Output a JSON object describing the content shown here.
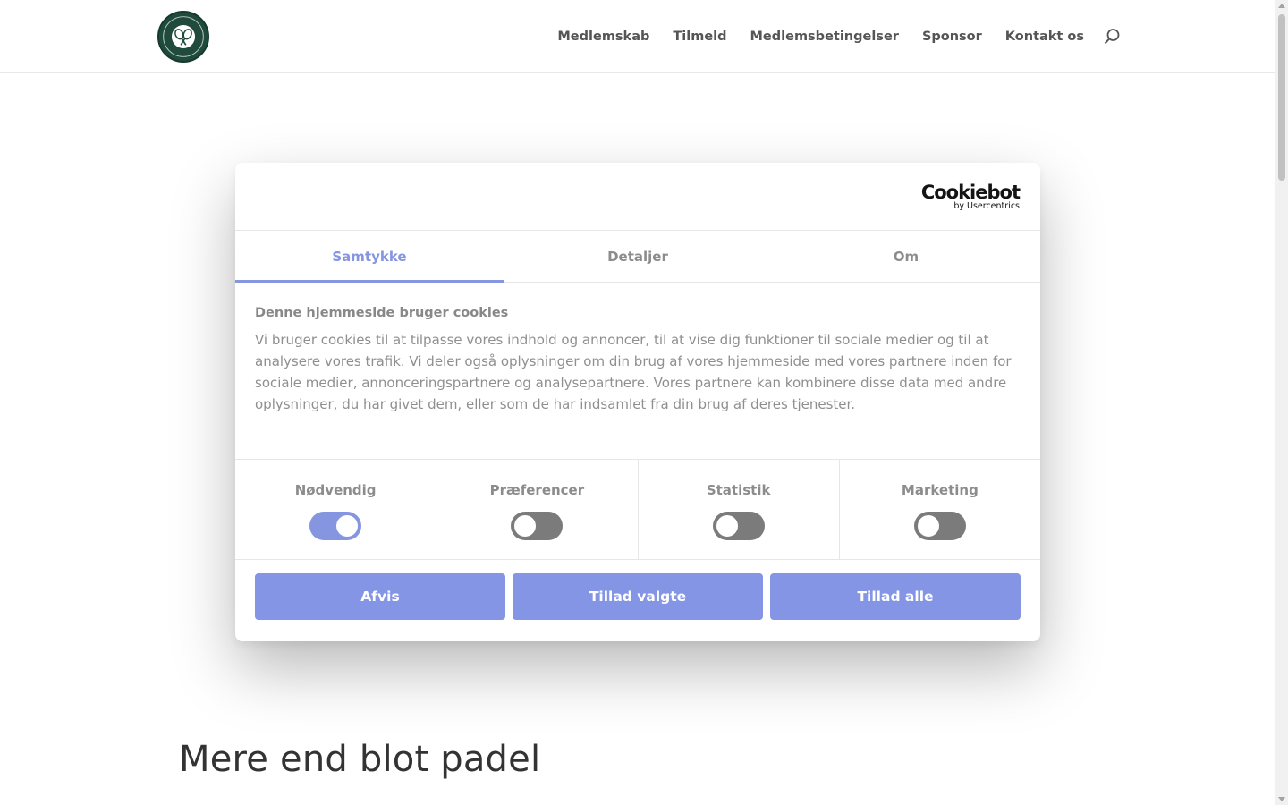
{
  "nav": {
    "items": [
      "Medlemskab",
      "Tilmeld",
      "Medlemsbetingelser",
      "Sponsor",
      "Kontakt os"
    ]
  },
  "icons": {
    "search": "search-icon",
    "logo": "club-logo-icon"
  },
  "colors": {
    "accent": "#8595e0",
    "button": "#8595e6",
    "logo_green": "#1f4a3c",
    "toggle_off": "#7b7b7b"
  },
  "page": {
    "heading": "Mere end blot padel"
  },
  "cookie": {
    "brand_name": "Cookiebot",
    "brand_sub": "by Usercentrics",
    "tabs": [
      {
        "label": "Samtykke",
        "active": true
      },
      {
        "label": "Detaljer",
        "active": false
      },
      {
        "label": "Om",
        "active": false
      }
    ],
    "title": "Denne hjemmeside bruger cookies",
    "description": "Vi bruger cookies til at tilpasse vores indhold og annoncer, til at vise dig funktioner til sociale medier og til at analysere vores trafik. Vi deler også oplysninger om din brug af vores hjemmeside med vores partnere inden for sociale medier, annonceringspartnere og analysepartnere. Vores partnere kan kombinere disse data med andre oplysninger, du har givet dem, eller som de har indsamlet fra din brug af deres tjenester.",
    "categories": [
      {
        "label": "Nødvendig",
        "enabled": true
      },
      {
        "label": "Præferencer",
        "enabled": false
      },
      {
        "label": "Statistik",
        "enabled": false
      },
      {
        "label": "Marketing",
        "enabled": false
      }
    ],
    "buttons": {
      "reject": "Afvis",
      "allow_selected": "Tillad valgte",
      "allow_all": "Tillad alle"
    }
  }
}
